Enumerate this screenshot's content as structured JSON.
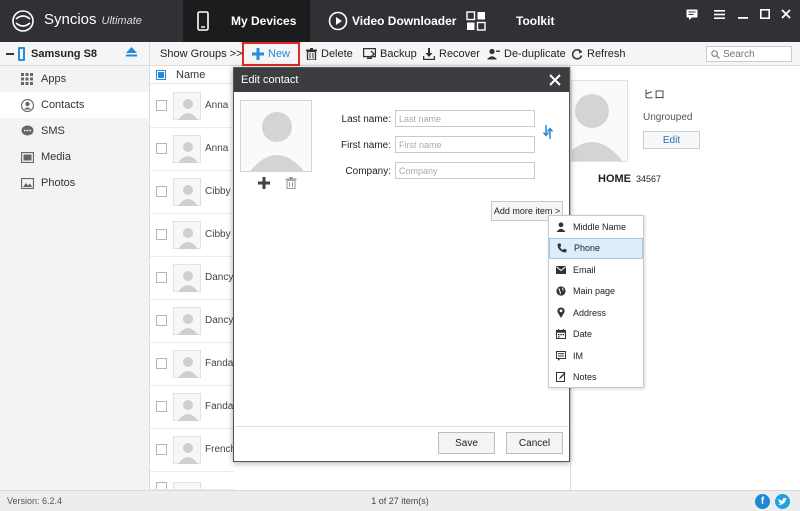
{
  "app": {
    "name": "Syncios",
    "edition": "Ultimate"
  },
  "nav": {
    "my_devices": "My Devices",
    "video_downloader": "Video Downloader",
    "toolkit": "Toolkit"
  },
  "device": {
    "name": "Samsung S8"
  },
  "sidebar": {
    "items": [
      {
        "label": "Apps"
      },
      {
        "label": "Contacts"
      },
      {
        "label": "SMS"
      },
      {
        "label": "Media"
      },
      {
        "label": "Photos"
      }
    ]
  },
  "toolbar": {
    "show_groups": "Show Groups  >>",
    "new": "New",
    "delete": "Delete",
    "backup": "Backup",
    "recover": "Recover",
    "deduplicate": "De-duplicate",
    "refresh": "Refresh",
    "search_placeholder": "Search"
  },
  "list": {
    "header_name": "Name",
    "contacts": [
      "Anna",
      "Anna",
      "Cibby",
      "Cibby",
      "Dancy",
      "Dancy",
      "Fanda",
      "Fanda",
      "French"
    ]
  },
  "detail": {
    "name": "ヒロ",
    "group": "Ungrouped",
    "edit": "Edit",
    "home_label": "HOME",
    "home_value": "34567"
  },
  "dialog": {
    "title": "Edit contact",
    "last_name_label": "Last name:",
    "last_name_placeholder": "Last name",
    "first_name_label": "First name:",
    "first_name_placeholder": "First name",
    "company_label": "Company:",
    "company_placeholder": "Company",
    "add_more": "Add more item >",
    "save": "Save",
    "cancel": "Cancel"
  },
  "dropdown": {
    "items": [
      {
        "label": "Middle Name",
        "icon": "person-icon"
      },
      {
        "label": "Phone",
        "icon": "phone-icon",
        "selected": true
      },
      {
        "label": "Email",
        "icon": "envelope-icon"
      },
      {
        "label": "Main page",
        "icon": "globe-icon"
      },
      {
        "label": "Address",
        "icon": "map-pin-icon"
      },
      {
        "label": "Date",
        "icon": "calendar-icon"
      },
      {
        "label": "IM",
        "icon": "chat-icon"
      },
      {
        "label": "Notes",
        "icon": "note-icon"
      }
    ]
  },
  "status": {
    "version": "Version: 6.2.4",
    "count": "1 of 27 item(s)"
  },
  "colors": {
    "accent": "#2a8ad6",
    "titlebar": "#2f3134",
    "highlight_border": "#e02828",
    "facebook": "#1e87d6",
    "twitter": "#1ea2e0"
  }
}
